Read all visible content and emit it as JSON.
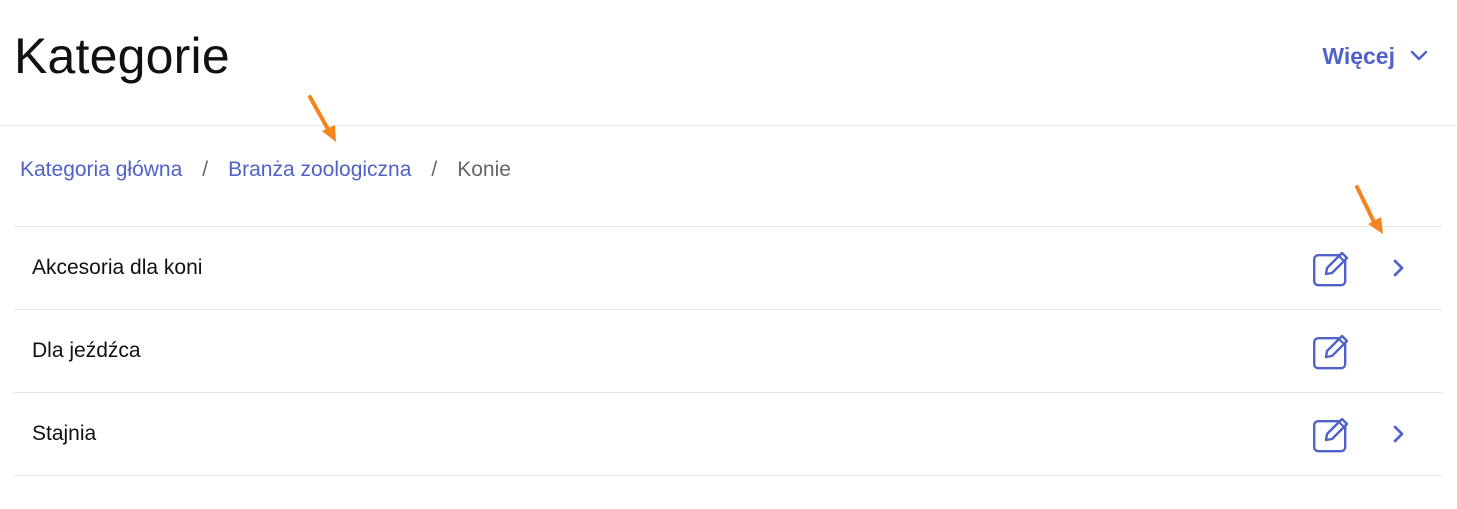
{
  "header": {
    "title": "Kategorie",
    "more_label": "Więcej"
  },
  "breadcrumb": {
    "items": [
      {
        "label": "Kategoria główna"
      },
      {
        "label": "Branża zoologiczna"
      },
      {
        "label": "Konie"
      }
    ],
    "separator": "/"
  },
  "categories": [
    {
      "name": "Akcesoria dla koni",
      "has_children": true
    },
    {
      "name": "Dla jeźdźca",
      "has_children": false
    },
    {
      "name": "Stajnia",
      "has_children": true
    }
  ],
  "icons": {
    "more": "chevron-down-icon",
    "edit": "edit-icon",
    "open": "chevron-right-icon",
    "annotation": "arrow-icon"
  },
  "colors": {
    "accent": "#5062c9",
    "annotation": "#f5841f",
    "text": "#111111",
    "muted": "#666666",
    "divider": "#e6e6e6"
  }
}
